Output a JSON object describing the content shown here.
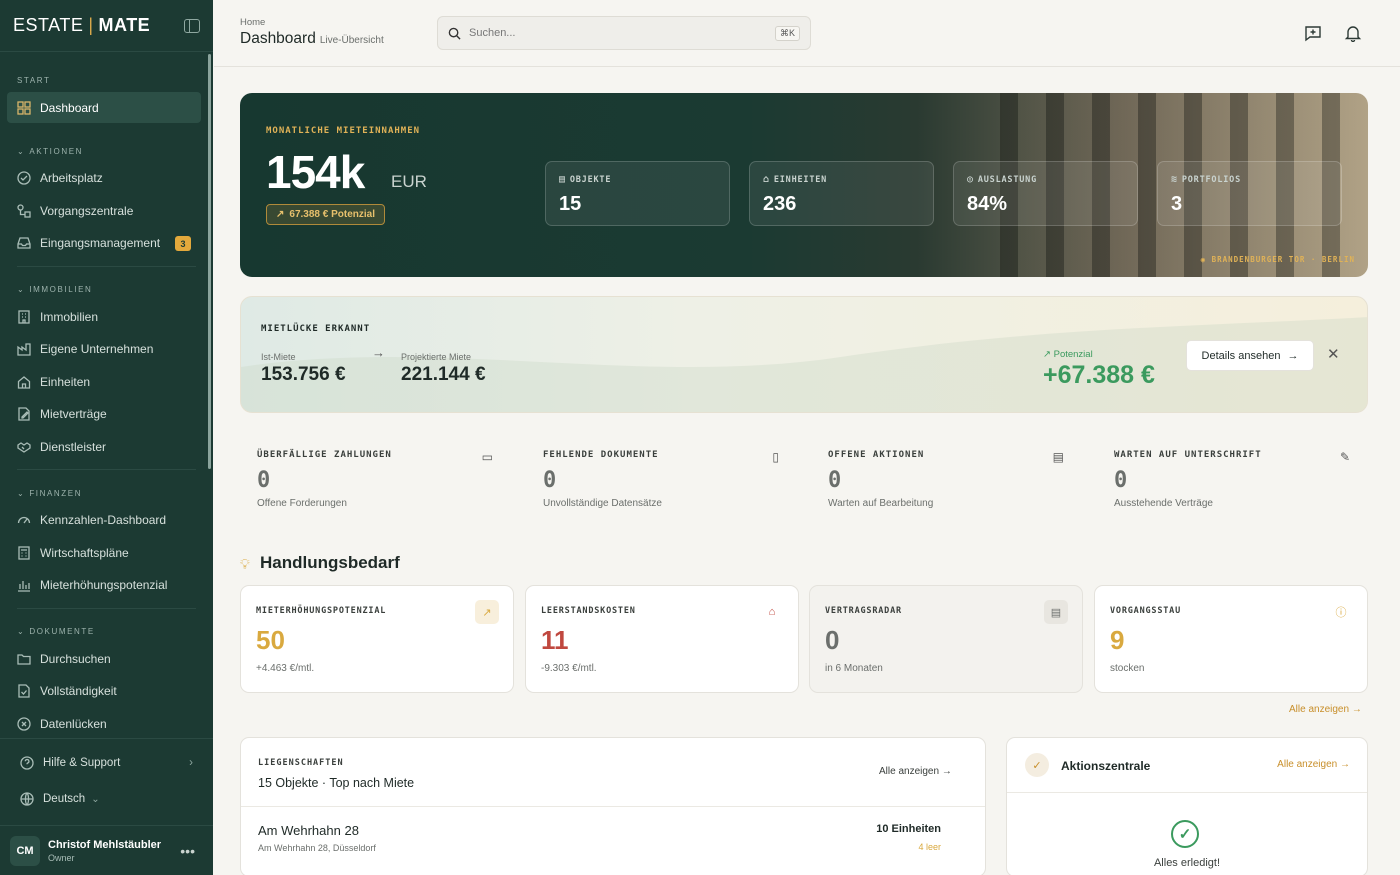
{
  "brand": {
    "left": "ESTATE",
    "right": "MATE"
  },
  "sidebar": {
    "sections": [
      {
        "label": "START",
        "items": [
          {
            "label": "Dashboard",
            "icon": "grid-icon",
            "active": true
          }
        ]
      },
      {
        "label": "AKTIONEN",
        "items": [
          {
            "label": "Arbeitsplatz",
            "icon": "check-circle-icon"
          },
          {
            "label": "Vorgangszentrale",
            "icon": "workflow-icon"
          },
          {
            "label": "Eingangsmanagement",
            "icon": "inbox-icon",
            "badge": "3"
          }
        ]
      },
      {
        "label": "IMMOBILIEN",
        "items": [
          {
            "label": "Immobilien",
            "icon": "building-icon"
          },
          {
            "label": "Eigene Unternehmen",
            "icon": "factory-icon"
          },
          {
            "label": "Einheiten",
            "icon": "home-icon"
          },
          {
            "label": "Mietverträge",
            "icon": "contract-icon"
          },
          {
            "label": "Dienstleister",
            "icon": "handshake-icon"
          }
        ]
      },
      {
        "label": "FINANZEN",
        "items": [
          {
            "label": "Kennzahlen-Dashboard",
            "icon": "gauge-icon"
          },
          {
            "label": "Wirtschaftspläne",
            "icon": "calculator-icon"
          },
          {
            "label": "Mieterhöhungspotenzial",
            "icon": "bar-chart-icon"
          }
        ]
      },
      {
        "label": "DOKUMENTE",
        "items": [
          {
            "label": "Durchsuchen",
            "icon": "folder-icon"
          },
          {
            "label": "Vollständigkeit",
            "icon": "file-check-icon"
          },
          {
            "label": "Datenlücken",
            "icon": "x-circle-icon"
          }
        ]
      }
    ],
    "help": "Hilfe & Support",
    "language": "Deutsch",
    "user": {
      "initials": "CM",
      "name": "Christof Mehlstäubler",
      "role": "Owner"
    }
  },
  "header": {
    "breadcrumb": "Home",
    "title": "Dashboard",
    "subtitle": "Live-Übersicht",
    "search_placeholder": "Suchen...",
    "search_shortcut": "⌘K"
  },
  "hero": {
    "label": "MONATLICHE MIETEINNAHMEN",
    "value": "154k",
    "unit": "EUR",
    "potential": "67.388 € Potenzial",
    "stats": [
      {
        "label": "OBJEKTE",
        "value": "15",
        "icon": "building-icon"
      },
      {
        "label": "EINHEITEN",
        "value": "236",
        "icon": "home-icon"
      },
      {
        "label": "AUSLASTUNG",
        "value": "84%",
        "icon": "target-icon"
      },
      {
        "label": "PORTFOLIOS",
        "value": "3",
        "icon": "layers-icon"
      }
    ],
    "location": "BRANDENBURGER TOR · BERLIN"
  },
  "gap": {
    "title": "MIETLÜCKE ERKANNT",
    "ist_label": "Ist-Miete",
    "ist_value": "153.756 €",
    "proj_label": "Projektierte Miete",
    "proj_value": "221.144 €",
    "potential_label": "Potenzial",
    "potential_value": "+67.388 €",
    "button": "Details ansehen"
  },
  "kpis": [
    {
      "label": "ÜBERFÄLLIGE ZAHLUNGEN",
      "value": "0",
      "desc": "Offene Forderungen",
      "icon": "cash-icon"
    },
    {
      "label": "FEHLENDE DOKUMENTE",
      "value": "0",
      "desc": "Unvollständige Datensätze",
      "icon": "file-search-icon"
    },
    {
      "label": "OFFENE AKTIONEN",
      "value": "0",
      "desc": "Warten auf Bearbeitung",
      "icon": "clipboard-icon"
    },
    {
      "label": "WARTEN AUF UNTERSCHRIFT",
      "value": "0",
      "desc": "Ausstehende Verträge",
      "icon": "signature-icon"
    }
  ],
  "handlungsbedarf": {
    "title": "Handlungsbedarf",
    "cards": [
      {
        "label": "MIETERHÖHUNGSPOTENZIAL",
        "value": "50",
        "desc": "+4.463 €/mtl.",
        "color": "#d9a93f",
        "icon": "trend-up-icon"
      },
      {
        "label": "LEERSTANDSKOSTEN",
        "value": "11",
        "desc": "-9.303 €/mtl.",
        "color": "#c0483f",
        "icon": "home-icon"
      },
      {
        "label": "VERTRAGSRADAR",
        "value": "0",
        "desc": "in 6 Monaten",
        "color": "#6b6f6c",
        "icon": "file-icon"
      },
      {
        "label": "VORGANGSSTAU",
        "value": "9",
        "desc": "stocken",
        "color": "#d9a93f",
        "icon": "alert-circle-icon"
      }
    ],
    "all_link": "Alle anzeigen"
  },
  "properties": {
    "label": "LIEGENSCHAFTEN",
    "subtitle": "15 Objekte · Top nach Miete",
    "all_link": "Alle anzeigen",
    "rows": [
      {
        "name": "Am Wehrhahn 28",
        "address": "Am Wehrhahn 28, Düsseldorf",
        "units": "10 Einheiten",
        "empty": "4 leer"
      }
    ]
  },
  "action_center": {
    "title": "Aktionszentrale",
    "all_link": "Alle anzeigen",
    "empty_text": "Alles erledigt!"
  }
}
